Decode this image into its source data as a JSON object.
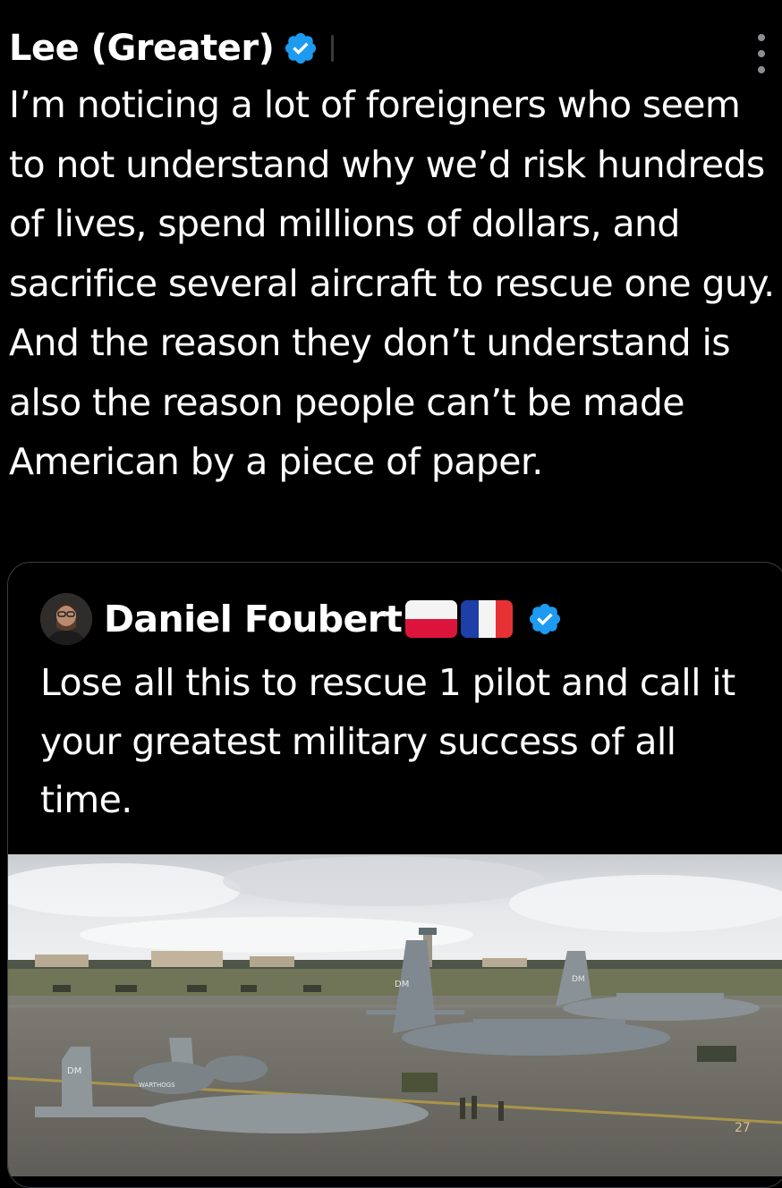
{
  "tweet": {
    "author_name": "Lee (Greater)",
    "verified": true,
    "text": "I’m noticing a lot of foreigners who seem to not understand why we’d risk hundreds of lives, spend millions of dollars, and sacrifice several aircraft to rescue one guy. And the reason they don’t understand is also the reason people can’t be made American by a piece of paper.",
    "more_icon": "more-vertical-icon"
  },
  "quote": {
    "author_name": "Daniel Foubert",
    "flags": [
      "poland-flag",
      "france-flag"
    ],
    "verified": true,
    "text": "Lose all this to rescue 1 pilot and call it your greatest military success of all time.",
    "image": {
      "description_icon": "military-aircraft-photo",
      "aircraft_tail_codes": [
        "DM",
        "DM",
        "DM"
      ],
      "nose_art": "WARTHOGS",
      "runway_marking": "27"
    }
  },
  "colors": {
    "background": "#000000",
    "text": "#ffffff",
    "verified": "#1d9bf0",
    "border": "#3a3d42",
    "muted": "#8b8f94"
  }
}
